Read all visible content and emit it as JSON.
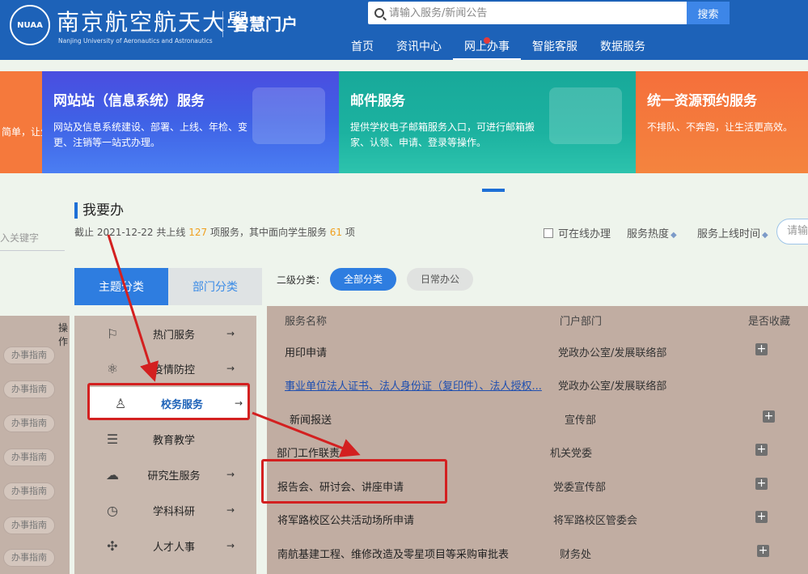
{
  "header": {
    "logo_seal": "NUAA",
    "logo_cn": "南京航空航天大學",
    "logo_en": "Nanjing University of Aeronautics and Astronautics",
    "portal_title": "智慧门户",
    "search_placeholder": "请输入服务/新闻公告",
    "search_button": "搜索",
    "nav": [
      "首页",
      "资讯中心",
      "网上办事",
      "智能客服",
      "数据服务"
    ],
    "active_nav": "网上办事"
  },
  "banners": [
    {
      "title": "",
      "desc": "简单，让生活"
    },
    {
      "title": "网站站（信息系统）服务",
      "desc": "网站及信息系统建设、部署、上线、年检、变更、注销等一站式办理。"
    },
    {
      "title": "邮件服务",
      "desc": "提供学校电子邮箱服务入口，可进行邮箱搬家、认领、申请、登录等操作。"
    },
    {
      "title": "统一资源预约服务",
      "desc": "不排队、不奔跑，让生活更高效。"
    }
  ],
  "section": {
    "title": "我要办",
    "summary_prefix": "截止 2021-12-22 共上线",
    "total": "127",
    "summary_mid": "项服务，其中面向学生服务",
    "student": "61",
    "summary_suffix": "项",
    "filter_online": "可在线办理",
    "sort_hot": "服务热度",
    "sort_time": "服务上线时间",
    "right_search": "请输",
    "left_keyword": "入关键字",
    "left_op": "操作"
  },
  "tabs": {
    "theme": "主题分类",
    "dept": "部门分类"
  },
  "categories": [
    {
      "icon": "⚐",
      "label": "热门服务"
    },
    {
      "icon": "⚛",
      "label": "疫情防控"
    },
    {
      "icon": "♙",
      "label": "校务服务"
    },
    {
      "icon": "☰",
      "label": "教育教学"
    },
    {
      "icon": "☁",
      "label": "研究生服务"
    },
    {
      "icon": "◷",
      "label": "学科科研"
    },
    {
      "icon": "✣",
      "label": "人才人事"
    }
  ],
  "guide_label": "办事指南",
  "sub_filter": {
    "label": "二级分类：",
    "all": "全部分类",
    "daily": "日常办公"
  },
  "table": {
    "headers": [
      "服务名称",
      "门户部门",
      "是否收藏"
    ],
    "rows": [
      {
        "name": "用印申请",
        "dept": "党政办公室/发展联络部",
        "link": false
      },
      {
        "name": "事业单位法人证书、法人身份证（复印件）、法人授权...",
        "dept": "党政办公室/发展联络部",
        "link": true
      },
      {
        "name": "新闻报送",
        "dept": "宣传部",
        "link": false
      },
      {
        "name": "部门工作联责",
        "dept": "机关党委",
        "link": false
      },
      {
        "name": "报告会、研讨会、讲座申请",
        "dept": "党委宣传部",
        "link": false
      },
      {
        "name": "将军路校区公共活动场所申请",
        "dept": "将军路校区管委会",
        "link": false
      },
      {
        "name": "南航基建工程、维修改造及零星项目等采购审批表",
        "dept": "财务处",
        "link": false
      }
    ]
  }
}
